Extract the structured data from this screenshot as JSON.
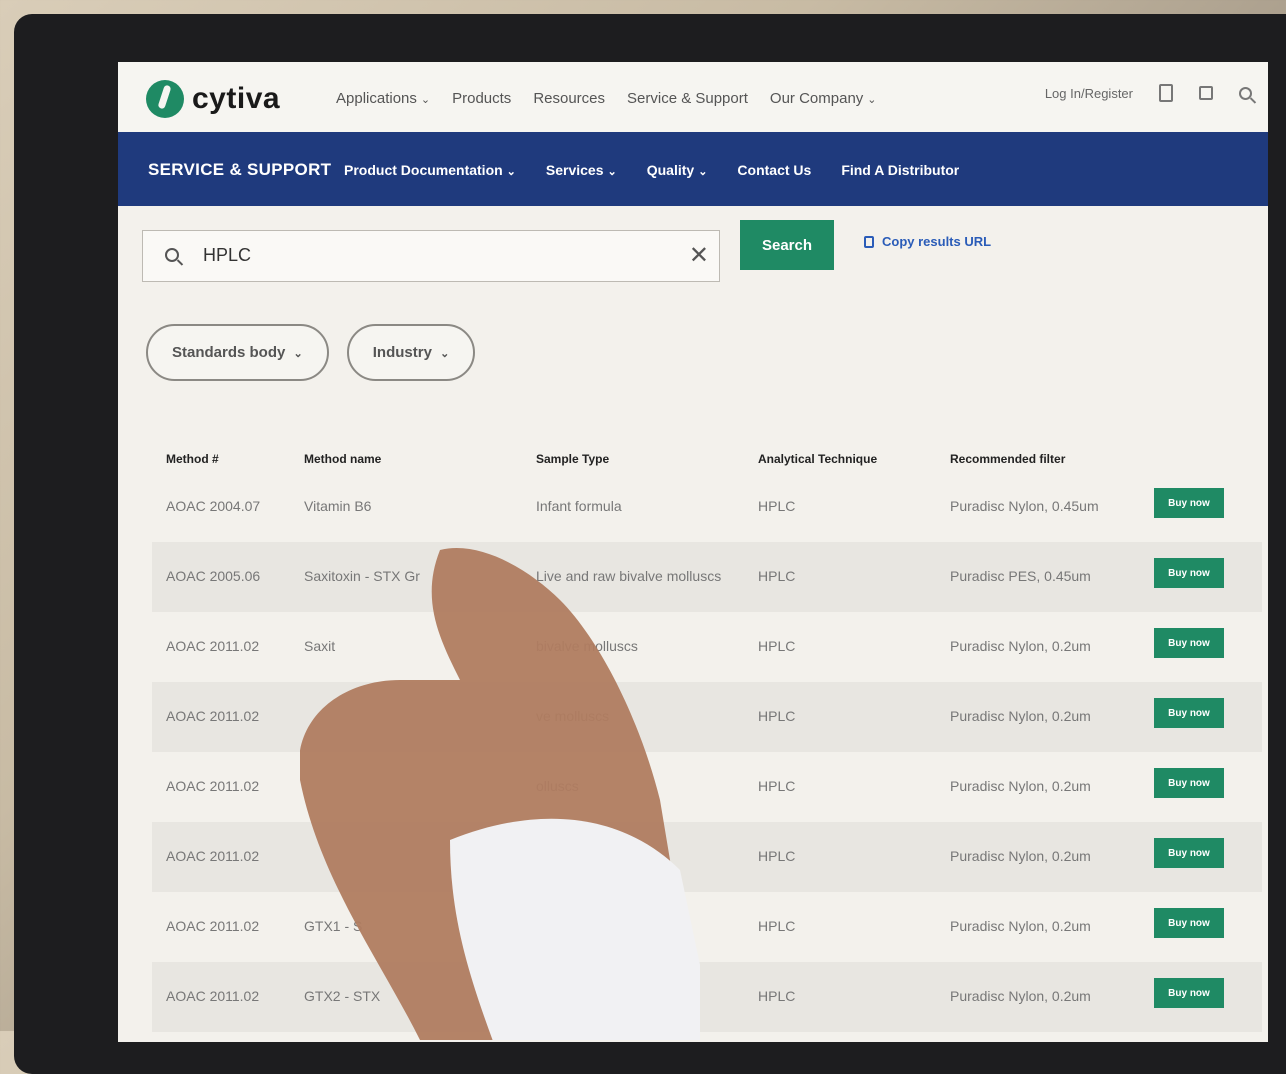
{
  "topnav": {
    "logo_text": "cytiva",
    "menu": [
      "Applications",
      "Products",
      "Resources",
      "Service & Support",
      "Our Company"
    ],
    "menu_has_dropdown": [
      true,
      false,
      false,
      false,
      true
    ],
    "login": "Log In/Register",
    "icons": [
      "document-icon",
      "bag-icon",
      "search-icon"
    ]
  },
  "subnav": {
    "brand": "SERVICE & SUPPORT",
    "items": [
      "Product Documentation",
      "Services",
      "Quality",
      "Contact Us",
      "Find A Distributor"
    ],
    "items_has_dropdown": [
      true,
      true,
      true,
      false,
      false
    ]
  },
  "search": {
    "value": "HPLC",
    "button": "Search",
    "copy_link": "Copy results URL"
  },
  "filters": [
    "Standards body",
    "Industry"
  ],
  "table": {
    "headers": [
      "Method #",
      "Method name",
      "Sample Type",
      "Analytical Technique",
      "Recommended filter"
    ],
    "rows": [
      [
        "AOAC 2004.07",
        "Vitamin B6",
        "Infant formula",
        "HPLC",
        "Puradisc Nylon, 0.45um"
      ],
      [
        "AOAC 2005.06",
        "Saxitoxin - STX Gr",
        "Live and raw bivalve molluscs",
        "HPLC",
        "Puradisc PES, 0.45um"
      ],
      [
        "AOAC 2011.02",
        "Saxit",
        "bivalve molluscs",
        "HPLC",
        "Puradisc Nylon, 0.2um"
      ],
      [
        "AOAC 2011.02",
        "",
        "ve molluscs",
        "HPLC",
        "Puradisc Nylon, 0.2um"
      ],
      [
        "AOAC 2011.02",
        "",
        "olluscs",
        "HPLC",
        "Puradisc Nylon, 0.2um"
      ],
      [
        "AOAC 2011.02",
        "",
        "uscs",
        "HPLC",
        "Puradisc Nylon, 0.2um"
      ],
      [
        "AOAC 2011.02",
        "GTX1 - S",
        "",
        "HPLC",
        "Puradisc Nylon, 0.2um"
      ],
      [
        "AOAC 2011.02",
        "GTX2 - STX",
        "",
        "HPLC",
        "Puradisc Nylon, 0.2um"
      ]
    ],
    "buy_label": "Buy now"
  },
  "colors": {
    "brand_green": "#1f8a64",
    "nav_blue": "#1f3a7d"
  }
}
